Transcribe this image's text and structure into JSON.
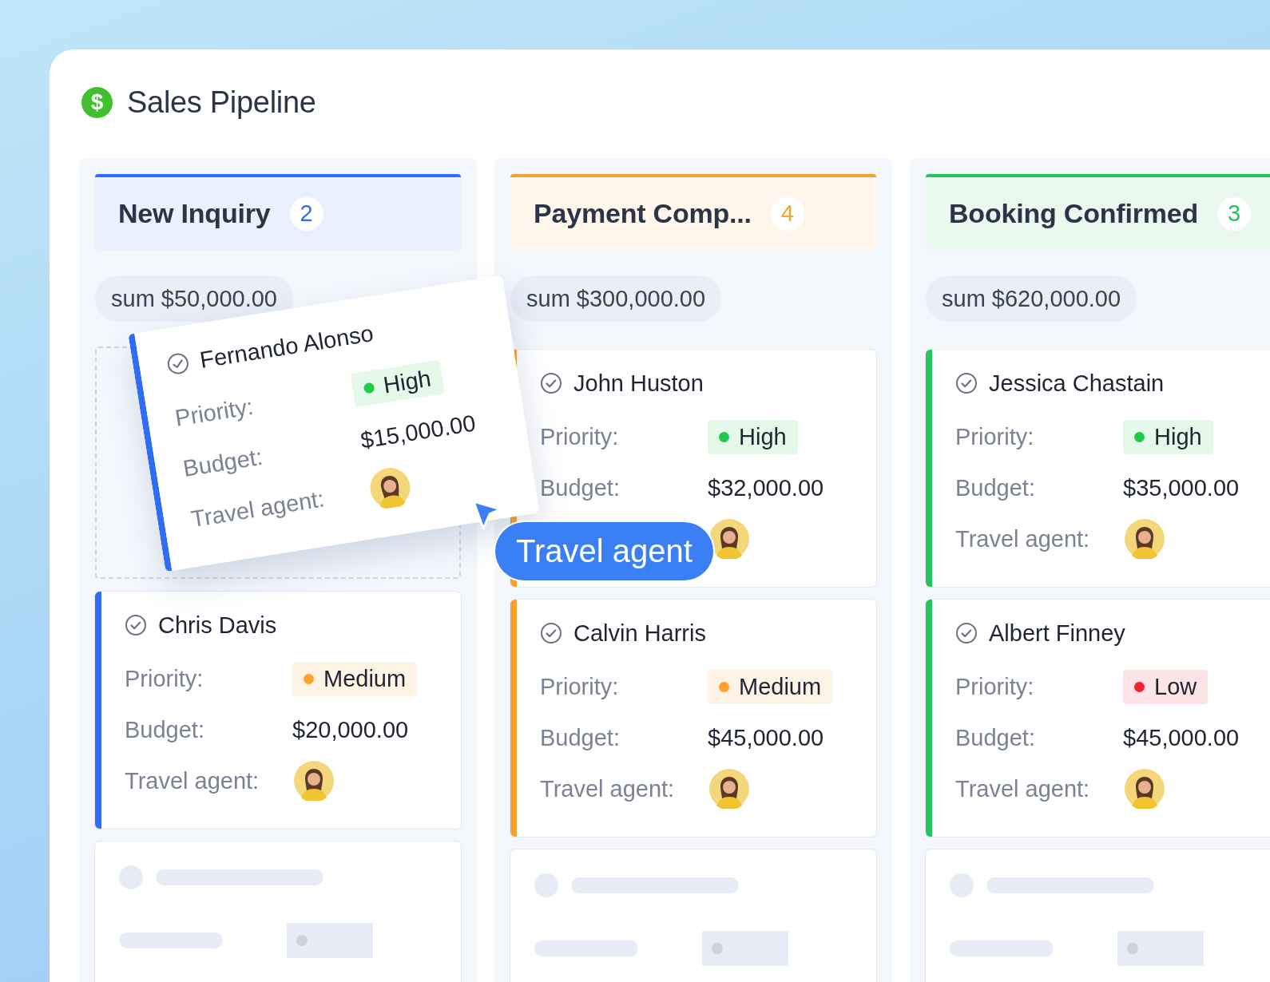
{
  "app": {
    "logo_symbol": "$",
    "title": "Sales Pipeline"
  },
  "columns": [
    {
      "title": "New Inquiry",
      "count": "2",
      "color": "#2f6df6",
      "sum": "sum $50,000.00",
      "cards": [
        {
          "kind": "drop-placeholder"
        },
        {
          "kind": "deal",
          "name": "Chris Davis",
          "priority_label": "Priority:",
          "priority": {
            "text": "Medium",
            "color": "#ff9f2e"
          },
          "budget_label": "Budget:",
          "budget": "$20,000.00",
          "agent_label": "Travel agent:"
        },
        {
          "kind": "skeleton"
        }
      ]
    },
    {
      "title": "Payment Comp...",
      "count": "4",
      "color": "#f7a12f",
      "sum": "sum $300,000.00",
      "cards": [
        {
          "kind": "deal",
          "name": "John Huston",
          "priority_label": "Priority:",
          "priority": {
            "text": "High",
            "color": "#1fc94a"
          },
          "budget_label": "Budget:",
          "budget": "$32,000.00"
        },
        {
          "kind": "deal",
          "name": "Calvin Harris",
          "priority_label": "Priority:",
          "priority": {
            "text": "Medium",
            "color": "#ff9f2e"
          },
          "budget_label": "Budget:",
          "budget": "$45,000.00",
          "agent_label": "Travel agent:"
        },
        {
          "kind": "skeleton"
        }
      ]
    },
    {
      "title": "Booking Confirmed",
      "count": "3",
      "color": "#22c55e",
      "sum": "sum $620,000.00",
      "cards": [
        {
          "kind": "deal",
          "name": "Jessica Chastain",
          "priority_label": "Priority:",
          "priority": {
            "text": "High",
            "color": "#1fc94a"
          },
          "budget_label": "Budget:",
          "budget": "$35,000.00",
          "agent_label": "Travel agent:"
        },
        {
          "kind": "deal",
          "name": "Albert Finney",
          "priority_label": "Priority:",
          "priority": {
            "text": "Low",
            "color": "#f5222d"
          },
          "budget_label": "Budget:",
          "budget": "$45,000.00",
          "agent_label": "Travel agent:"
        },
        {
          "kind": "skeleton"
        }
      ]
    }
  ],
  "dragged_card": {
    "name": "Fernando Alonso",
    "priority_label": "Priority:",
    "priority": {
      "text": "High",
      "color": "#1fc94a"
    },
    "budget_label": "Budget:",
    "budget": "$15,000.00",
    "agent_label": "Travel agent:"
  },
  "drag_tooltip": "Travel agent"
}
